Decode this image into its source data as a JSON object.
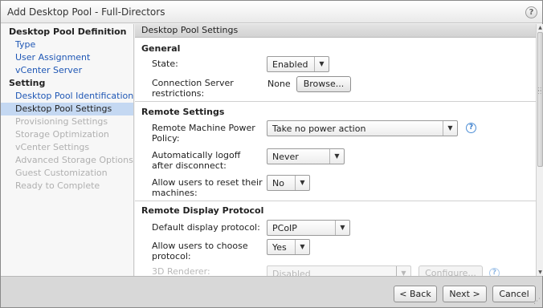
{
  "window": {
    "title": "Add Desktop Pool - Full-Directors",
    "help_glyph": "?"
  },
  "sidebar": {
    "sections": [
      {
        "heading": "Desktop Pool Definition",
        "items": [
          {
            "label": "Type",
            "state": "link"
          },
          {
            "label": "User Assignment",
            "state": "link"
          },
          {
            "label": "vCenter Server",
            "state": "link"
          }
        ]
      },
      {
        "heading": "Setting",
        "items": [
          {
            "label": "Desktop Pool Identification",
            "state": "link"
          },
          {
            "label": "Desktop Pool Settings",
            "state": "selected"
          },
          {
            "label": "Provisioning Settings",
            "state": "disabled"
          },
          {
            "label": "Storage Optimization",
            "state": "disabled"
          },
          {
            "label": "vCenter Settings",
            "state": "disabled"
          },
          {
            "label": "Advanced Storage Options",
            "state": "disabled"
          },
          {
            "label": "Guest Customization",
            "state": "disabled"
          },
          {
            "label": "Ready to Complete",
            "state": "disabled"
          }
        ]
      }
    ]
  },
  "content": {
    "header": "Desktop Pool Settings",
    "general": {
      "title": "General",
      "state_label": "State:",
      "state_value": "Enabled",
      "conn_label": "Connection Server restrictions:",
      "conn_value": "None",
      "browse_label": "Browse..."
    },
    "remote": {
      "title": "Remote Settings",
      "power_label": "Remote Machine Power Policy:",
      "power_value": "Take no power action",
      "logoff_label": "Automatically logoff after disconnect:",
      "logoff_value": "Never",
      "reset_label": "Allow users to reset their machines:",
      "reset_value": "No"
    },
    "display": {
      "title": "Remote Display Protocol",
      "protocol_label": "Default display protocol:",
      "protocol_value": "PCoIP",
      "choose_label": "Allow users to choose protocol:",
      "choose_value": "Yes",
      "renderer_label": "3D Renderer:",
      "renderer_value": "Disabled",
      "configure_label": "Configure..."
    }
  },
  "footer": {
    "back_label": "< Back",
    "next_label": "Next >",
    "cancel_label": "Cancel"
  },
  "icons": {
    "dropdown_arrow": "▼",
    "info": "?",
    "scroll_up": "▲",
    "scroll_down": "▼"
  }
}
